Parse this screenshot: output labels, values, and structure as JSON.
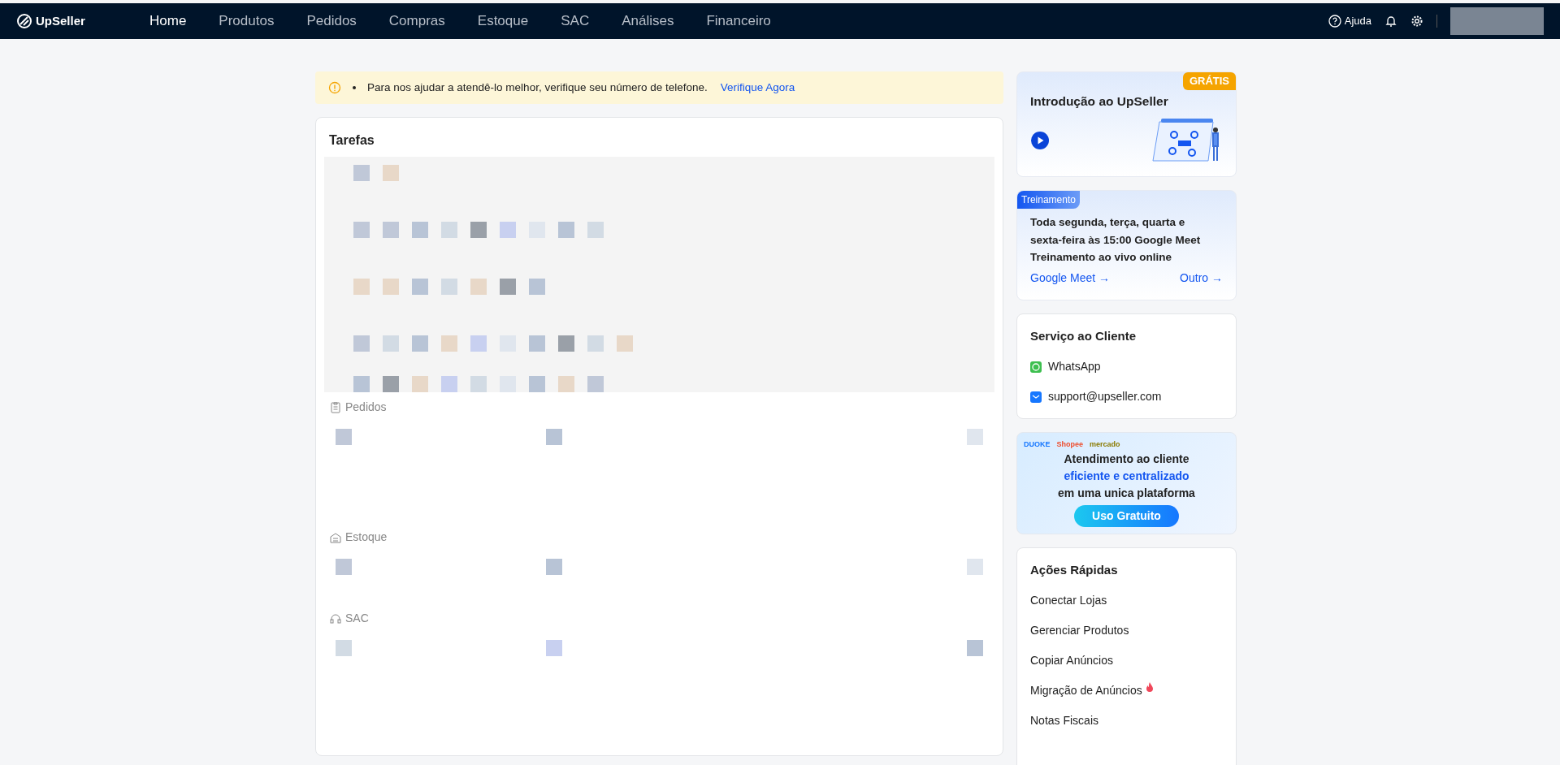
{
  "navbar": {
    "brand": "UpSeller",
    "items": [
      {
        "label": "Home",
        "selected": true
      },
      {
        "label": "Produtos",
        "selected": false
      },
      {
        "label": "Pedidos",
        "selected": false
      },
      {
        "label": "Compras",
        "selected": false
      },
      {
        "label": "Estoque",
        "selected": false
      },
      {
        "label": "SAC",
        "selected": false
      },
      {
        "label": "Análises",
        "selected": false
      },
      {
        "label": "Financeiro",
        "selected": false
      }
    ],
    "help": "Ajuda"
  },
  "alert": {
    "text": "Para nos ajudar a atendê-lo melhor, verifique seu número de telefone.",
    "link": "Verifique Agora"
  },
  "tasks": {
    "title": "Tarefas",
    "sections": [
      {
        "kind": "orders",
        "label": "Pedidos"
      },
      {
        "kind": "stock",
        "label": "Estoque"
      },
      {
        "kind": "support",
        "label": "SAC"
      }
    ]
  },
  "intro_card": {
    "title": "Introdução ao UpSeller",
    "badge": "GRÁTIS"
  },
  "training_card": {
    "badge": "Treinamento",
    "text": "Toda segunda, terça, quarta e sexta-feira às 15:00 Google Meet Treinamento ao vivo online",
    "links": [
      "Google Meet →",
      "Outro →"
    ]
  },
  "service_card": {
    "title": "Serviço ao Cliente",
    "contacts": [
      {
        "kind": "whatsapp",
        "label": "WhatsApp"
      },
      {
        "kind": "email",
        "label": "support@upseller.com"
      }
    ]
  },
  "promo_banner": {
    "logos": [
      "DUOKE",
      "Shopee",
      "mercado"
    ],
    "line_1": "Atendimento ao cliente",
    "line_2": "eficiente e centralizado",
    "line_3": "em uma unica plataforma",
    "button": "Uso Gratuito"
  },
  "quick_actions": {
    "title": "Ações Rápidas",
    "items": [
      {
        "label": "Conectar Lojas",
        "hot": false
      },
      {
        "label": "Gerenciar Produtos",
        "hot": false
      },
      {
        "label": "Copiar Anúncios",
        "hot": false
      },
      {
        "label": "Migração de Anúncios",
        "hot": true
      },
      {
        "label": "Notas Fiscais",
        "hot": false
      }
    ]
  }
}
